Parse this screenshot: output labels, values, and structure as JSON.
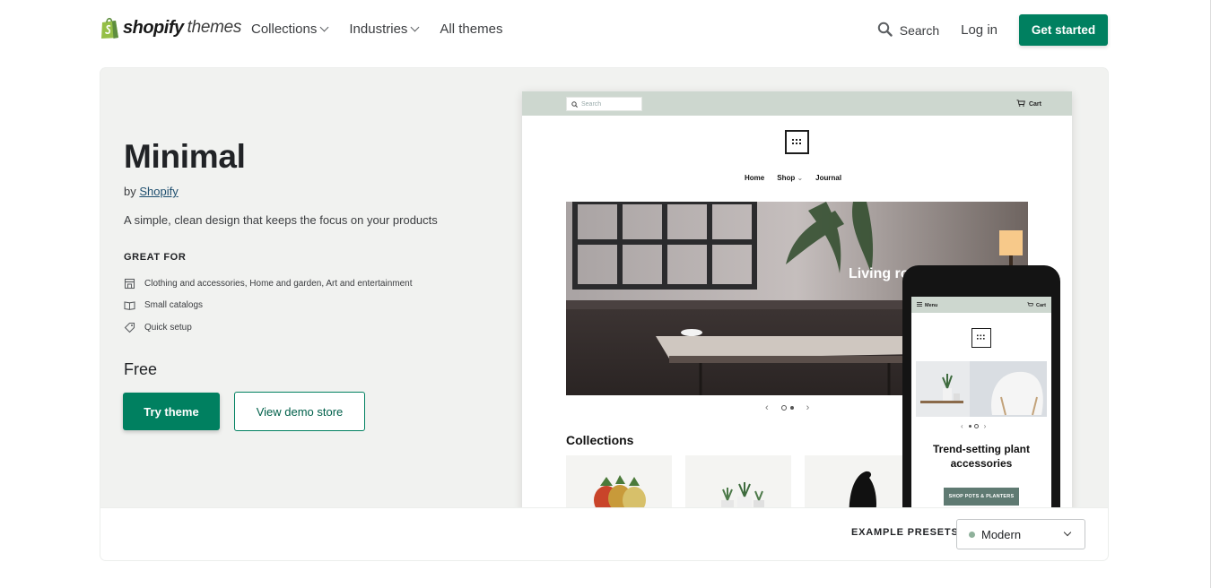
{
  "brand": {
    "name": "shopify",
    "suffix": "themes",
    "brand_color": "#008060",
    "bag_color": "#95bf47"
  },
  "nav": {
    "items": [
      {
        "label": "Collections",
        "has_dropdown": true
      },
      {
        "label": "Industries",
        "has_dropdown": true
      },
      {
        "label": "All themes",
        "has_dropdown": false
      }
    ],
    "search_label": "Search",
    "login_label": "Log in",
    "cta_label": "Get started"
  },
  "theme": {
    "title": "Minimal",
    "by_prefix": "by",
    "author": "Shopify",
    "description": "A simple, clean design that keeps the focus on your products",
    "great_for_heading": "GREAT FOR",
    "features": [
      {
        "icon": "store-icon",
        "text": "Clothing and accessories, Home and garden, Art and entertainment"
      },
      {
        "icon": "book-icon",
        "text": "Small catalogs"
      },
      {
        "icon": "tag-icon",
        "text": "Quick setup"
      }
    ],
    "price": "Free",
    "try_label": "Try theme",
    "demo_label": "View demo store"
  },
  "preview": {
    "desktop": {
      "search_placeholder": "Search",
      "cart_label": "Cart",
      "menu": [
        "Home",
        "Shop",
        "Journal"
      ],
      "hero_text": "Living ro",
      "collections_title": "Collections",
      "header_color": "#cdd7cf"
    },
    "mobile": {
      "menu_label": "Menu",
      "cart_label": "Cart",
      "headline": "Trend-setting plant accessories",
      "button_label": "SHOP POTS & PLANTERS"
    }
  },
  "presets": {
    "label": "EXAMPLE PRESETS",
    "selected": "Modern",
    "selected_swatch": "#8fb19b"
  }
}
